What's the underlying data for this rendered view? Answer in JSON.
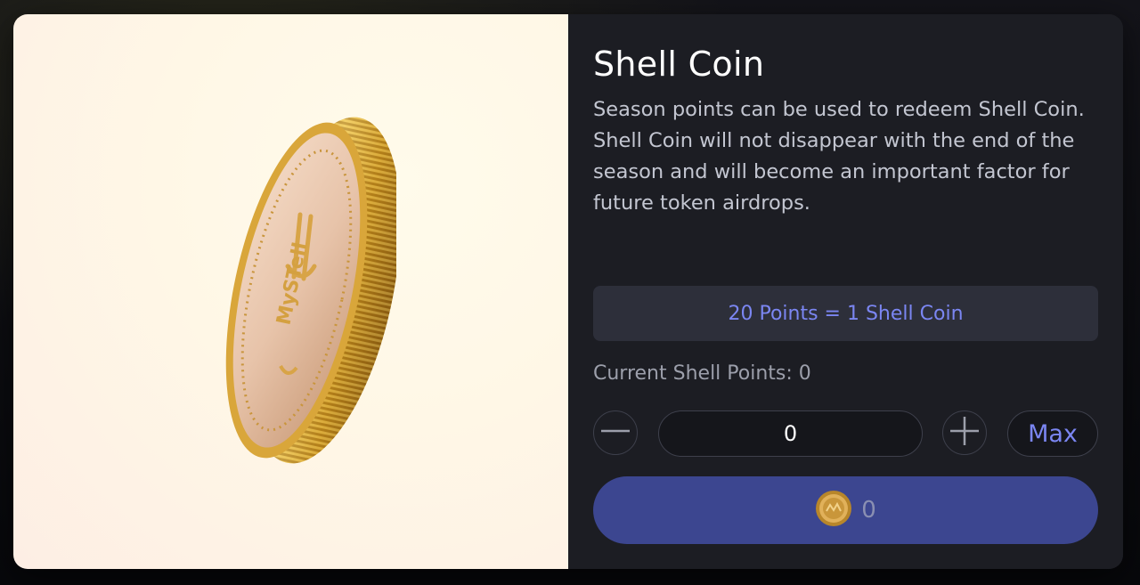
{
  "modal": {
    "title": "Shell Coin",
    "description": "Season points can be used to redeem Shell Coin. Shell Coin will not disappear with the end of the season and will become an important factor for future token airdrops.",
    "rate_text": "20 Points = 1 Shell Coin",
    "current_points_text": "Current Shell Points: 0",
    "quantity_value": "0",
    "max_label": "Max",
    "redeem_amount": "0"
  },
  "coin_art": {
    "engraving": "MySTell"
  },
  "colors": {
    "accent": "#7b86f2",
    "panel_bg": "#1c1d23",
    "rate_box_bg": "#2d2f3a",
    "redeem_button_bg": "#3c4690",
    "art_bg": "#fff7e6",
    "coin_gold": "#d9a63a"
  },
  "icons": {
    "minus": "minus-icon",
    "plus": "plus-icon",
    "coin": "shell-coin-icon"
  }
}
